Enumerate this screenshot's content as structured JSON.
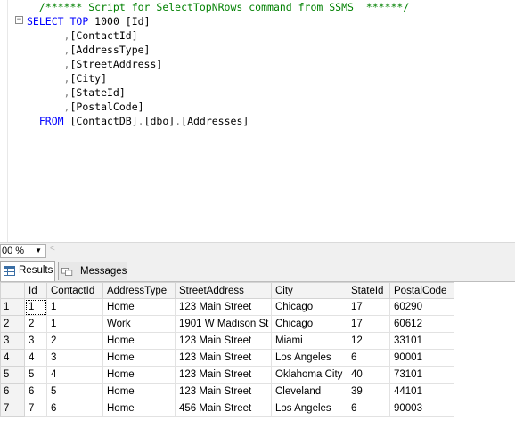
{
  "editor": {
    "lines": [
      [
        {
          "t": "  /****** Script for SelectTopNRows command from SSMS  ******/",
          "c": "comment"
        }
      ],
      [
        {
          "t": "SELECT ",
          "c": "kw"
        },
        {
          "t": "TOP ",
          "c": "kw"
        },
        {
          "t": "1000 ",
          "c": "black"
        },
        {
          "t": "[Id]",
          "c": "black"
        }
      ],
      [
        {
          "t": "      ,",
          "c": "gray"
        },
        {
          "t": "[ContactId]",
          "c": "black"
        }
      ],
      [
        {
          "t": "      ,",
          "c": "gray"
        },
        {
          "t": "[AddressType]",
          "c": "black"
        }
      ],
      [
        {
          "t": "      ,",
          "c": "gray"
        },
        {
          "t": "[StreetAddress]",
          "c": "black"
        }
      ],
      [
        {
          "t": "      ,",
          "c": "gray"
        },
        {
          "t": "[City]",
          "c": "black"
        }
      ],
      [
        {
          "t": "      ,",
          "c": "gray"
        },
        {
          "t": "[StateId]",
          "c": "black"
        }
      ],
      [
        {
          "t": "      ,",
          "c": "gray"
        },
        {
          "t": "[PostalCode]",
          "c": "black"
        }
      ],
      [
        {
          "t": "  FROM ",
          "c": "kw"
        },
        {
          "t": "[ContactDB]",
          "c": "black"
        },
        {
          "t": ".",
          "c": "gray"
        },
        {
          "t": "[dbo]",
          "c": "black"
        },
        {
          "t": ".",
          "c": "gray"
        },
        {
          "t": "[Addresses]",
          "c": "black"
        }
      ]
    ],
    "colors": {
      "comment": "#008000",
      "kw": "#0000ff",
      "gray": "#808080",
      "black": "#000000"
    }
  },
  "zoom": {
    "value": "00 %"
  },
  "tabs": {
    "results": "Results",
    "messages": "Messages"
  },
  "grid": {
    "columns": [
      "Id",
      "ContactId",
      "AddressType",
      "StreetAddress",
      "City",
      "StateId",
      "PostalCode"
    ],
    "rows": [
      [
        "1",
        "1",
        "1",
        "Home",
        "123 Main Street",
        "Chicago",
        "17",
        "60290"
      ],
      [
        "2",
        "2",
        "1",
        "Work",
        "1901 W Madison St",
        "Chicago",
        "17",
        "60612"
      ],
      [
        "3",
        "3",
        "2",
        "Home",
        "123 Main Street",
        "Miami",
        "12",
        "33101"
      ],
      [
        "4",
        "4",
        "3",
        "Home",
        "123 Main Street",
        "Los Angeles",
        "6",
        "90001"
      ],
      [
        "5",
        "5",
        "4",
        "Home",
        "123 Main Street",
        "Oklahoma City",
        "40",
        "73101"
      ],
      [
        "6",
        "6",
        "5",
        "Home",
        "123 Main Street",
        "Cleveland",
        "39",
        "44101"
      ],
      [
        "7",
        "7",
        "6",
        "Home",
        "456 Main Street",
        "Los Angeles",
        "6",
        "90003"
      ]
    ]
  }
}
